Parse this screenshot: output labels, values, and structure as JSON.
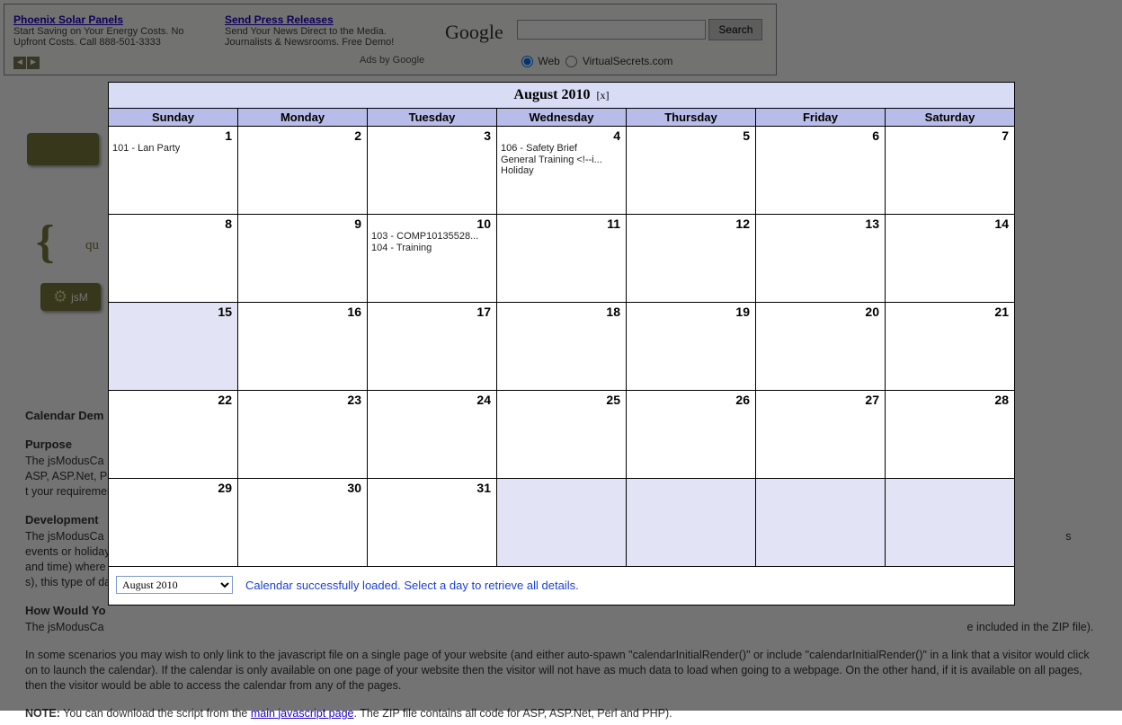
{
  "ads": {
    "phoenix_title": "Phoenix Solar Panels",
    "phoenix_sub": "Start Saving on Your Energy Costs. No Upfront Costs. Call 888-501-3333",
    "press_title": "Send Press Releases",
    "press_sub": "Send Your News Direct to the Media. Journalists & Newsrooms. Free Demo!",
    "ads_by": "Ads by Google",
    "logo": "Google",
    "search_btn": "Search",
    "radio_web": "Web",
    "radio_vs": "VirtualSecrets.com",
    "arrow_l": "◄",
    "arrow_r": "►"
  },
  "side": {
    "tab1": " ",
    "brace": "{",
    "qu": "qu",
    "jsm": "jsM",
    "gear": "⚙"
  },
  "content": {
    "h_demo": "Calendar Dem",
    "h_purpose": "Purpose",
    "p_purpose": "The jsModusCa                                                                                                                                                                                                                                                                                                                        ASP, ASP.Net, Perl,                                                                                                                                                                                                                                                                                                                           t your requirements ma",
    "h_dev": "Development",
    "p_dev": "The jsModusCa                                                                                                                                                                                                                                                                                                                    s events or holidays) are av                                                                                                                                                                                                                                                                                                                  and time) where mouse ov                                                                                                                                                                                                                                                                                                                          s), this type of data is s",
    "h_how": "How Would Yo",
    "p_how1a": "The jsModusCa",
    "p_how1b": "e included in the ZIP file). ",
    "p_how2": "In some scenarios you may wish to only link to the javascript file on a single page of your website (and either auto-spawn \"calendarInitialRender()\" or include \"calendarInitialRender()\" in a link that a visitor would click on to launch the calendar). If the calendar is only available on one page of your website then the visitor will not have as much data to load when going to a webpage. On the other hand, if it is available on all pages, then the visitor would be able to access the calendar from any of the pages.",
    "note_b": "NOTE:",
    "note_1": " You can download the script from the ",
    "note_link": "main javascript page",
    "note_2": ". The ZIP file contains all code for ASP, ASP.Net, Perl and PHP)."
  },
  "calendar": {
    "title": "August 2010",
    "close": "[x]",
    "days": [
      "Sunday",
      "Monday",
      "Tuesday",
      "Wednesday",
      "Thursday",
      "Friday",
      "Saturday"
    ],
    "weeks": [
      [
        {
          "n": "1",
          "e": [
            "101 - Lan Party"
          ]
        },
        {
          "n": "2",
          "e": []
        },
        {
          "n": "3",
          "e": []
        },
        {
          "n": "4",
          "e": [
            "106 - Safety Brief",
            "General Training <!--i...",
            "Holiday"
          ]
        },
        {
          "n": "5",
          "e": []
        },
        {
          "n": "6",
          "e": []
        },
        {
          "n": "7",
          "e": []
        }
      ],
      [
        {
          "n": "8",
          "e": []
        },
        {
          "n": "9",
          "e": []
        },
        {
          "n": "10",
          "e": [
            "103 - COMP10135528...",
            "104 - Training"
          ]
        },
        {
          "n": "11",
          "e": []
        },
        {
          "n": "12",
          "e": []
        },
        {
          "n": "13",
          "e": []
        },
        {
          "n": "14",
          "e": []
        }
      ],
      [
        {
          "n": "15",
          "e": [],
          "other": true
        },
        {
          "n": "16",
          "e": []
        },
        {
          "n": "17",
          "e": []
        },
        {
          "n": "18",
          "e": []
        },
        {
          "n": "19",
          "e": []
        },
        {
          "n": "20",
          "e": []
        },
        {
          "n": "21",
          "e": []
        }
      ],
      [
        {
          "n": "22",
          "e": []
        },
        {
          "n": "23",
          "e": []
        },
        {
          "n": "24",
          "e": []
        },
        {
          "n": "25",
          "e": []
        },
        {
          "n": "26",
          "e": []
        },
        {
          "n": "27",
          "e": []
        },
        {
          "n": "28",
          "e": []
        }
      ],
      [
        {
          "n": "29",
          "e": []
        },
        {
          "n": "30",
          "e": []
        },
        {
          "n": "31",
          "e": []
        },
        {
          "n": "",
          "e": [],
          "other": true
        },
        {
          "n": "",
          "e": [],
          "other": true
        },
        {
          "n": "",
          "e": [],
          "other": true
        },
        {
          "n": "",
          "e": [],
          "other": true
        }
      ]
    ],
    "month_select": "August 2010",
    "status": "Calendar successfully loaded. Select a day to retrieve all details."
  }
}
